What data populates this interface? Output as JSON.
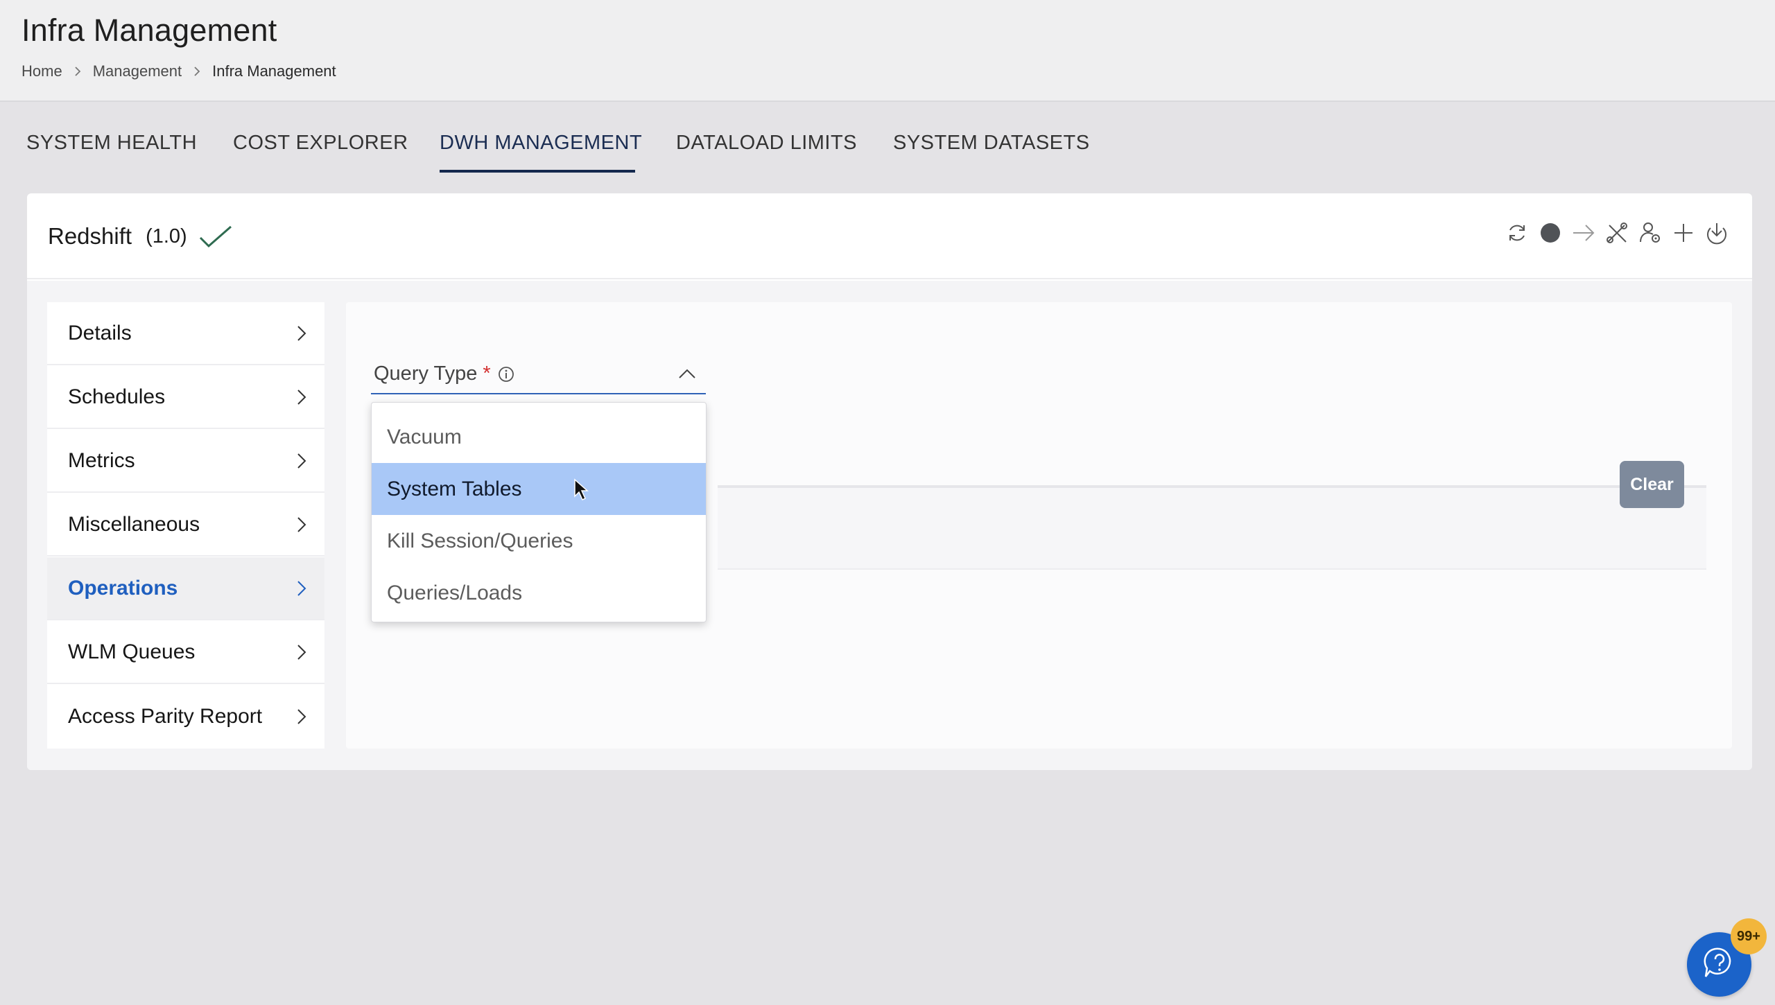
{
  "header": {
    "title": "Infra Management",
    "breadcrumb": [
      "Home",
      "Management",
      "Infra Management"
    ]
  },
  "tabs": [
    {
      "label": "SYSTEM HEALTH",
      "active": false
    },
    {
      "label": "COST EXPLORER",
      "active": false
    },
    {
      "label": "DWH MANAGEMENT",
      "active": true
    },
    {
      "label": "DATALOAD LIMITS",
      "active": false
    },
    {
      "label": "SYSTEM DATASETS",
      "active": false
    }
  ],
  "card": {
    "title": "Redshift",
    "version": "(1.0)",
    "status_icon": "check-icon",
    "toolbar_icons": [
      "refresh-icon",
      "status-dot-icon",
      "arrow-right-icon",
      "tools-icon",
      "user-settings-icon",
      "plus-icon",
      "download-icon"
    ]
  },
  "sidebar": {
    "items": [
      {
        "label": "Details",
        "active": false
      },
      {
        "label": "Schedules",
        "active": false
      },
      {
        "label": "Metrics",
        "active": false
      },
      {
        "label": "Miscellaneous",
        "active": false
      },
      {
        "label": "Operations",
        "active": true
      },
      {
        "label": "WLM Queues",
        "active": false
      },
      {
        "label": "Access Parity Report",
        "active": false
      }
    ]
  },
  "main": {
    "query_type": {
      "label": "Query Type",
      "required_marker": "*",
      "expanded": true,
      "options": [
        {
          "label": "Vacuum",
          "highlighted": false
        },
        {
          "label": "System Tables",
          "highlighted": true
        },
        {
          "label": "Kill Session/Queries",
          "highlighted": false
        },
        {
          "label": "Queries/Loads",
          "highlighted": false
        }
      ]
    },
    "clear_label": "Clear"
  },
  "help": {
    "badge": "99+"
  },
  "colors": {
    "accent": "#1f5fbf",
    "tab_active": "#14284d",
    "option_highlight": "#a9c8f7",
    "clear_button": "#7e8a9c",
    "badge": "#f2b63c",
    "required": "#d32f2f"
  }
}
